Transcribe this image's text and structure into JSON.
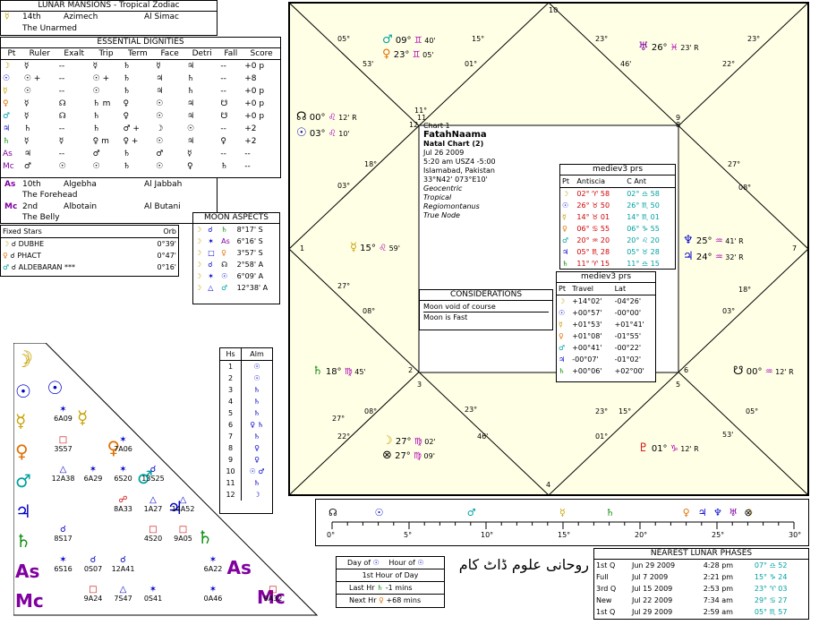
{
  "lunar_mansions": {
    "title": "LUNAR MANSIONS - Tropical Zodiac",
    "row1": {
      "num": "14th",
      "name": "Azimech",
      "arabic": "Al Simac"
    },
    "row1_sub": "The Unarmed",
    "row2": {
      "num": "10th",
      "name": "Algebha",
      "arabic": "Al Jabbah"
    },
    "row2_sub": "The Forehead",
    "row3": {
      "num": "2nd",
      "name": "Albotain",
      "arabic": "Al Butani"
    },
    "row3_sub": "The Belly"
  },
  "essential_dignities": {
    "title": "ESSENTIAL DIGNITIES",
    "headers": [
      "Pt",
      "Ruler",
      "Exalt",
      "Trip",
      "Term",
      "Face",
      "Detri",
      "Fall",
      "Score"
    ],
    "rows": [
      {
        "pt": "☽",
        "ruler": "☿",
        "exalt": "--",
        "trip": "☿",
        "term": "♄",
        "face": "☿",
        "detri": "♃",
        "fall": "--",
        "score": "+0 p"
      },
      {
        "pt": "☉",
        "ruler": "☉ +",
        "exalt": "--",
        "trip": "☉ +",
        "term": "♄",
        "face": "♃",
        "detri": "♄",
        "fall": "--",
        "score": "+8"
      },
      {
        "pt": "☿",
        "ruler": "☉",
        "exalt": "--",
        "trip": "☉",
        "term": "♄",
        "face": "♃",
        "detri": "♄",
        "fall": "--",
        "score": "+0 p"
      },
      {
        "pt": "♀",
        "ruler": "☿",
        "exalt": "☊",
        "trip": "♄ m",
        "term": "♀",
        "face": "☉",
        "detri": "♃",
        "fall": "☋",
        "score": "+0 p"
      },
      {
        "pt": "♂",
        "ruler": "☿",
        "exalt": "☊",
        "trip": "♄",
        "term": "♀",
        "face": "☉",
        "detri": "♃",
        "fall": "☋",
        "score": "+0 p"
      },
      {
        "pt": "♃",
        "ruler": "♄",
        "exalt": "--",
        "trip": "♄",
        "term": "♂ +",
        "face": "☽",
        "detri": "☉",
        "fall": "--",
        "score": "+2"
      },
      {
        "pt": "♄",
        "ruler": "☿",
        "exalt": "☿",
        "trip": "♀ m",
        "term": "♀ +",
        "face": "☉",
        "detri": "♃",
        "fall": "♀",
        "score": "+2"
      },
      {
        "pt": "As",
        "ruler": "♃",
        "exalt": "--",
        "trip": "♂",
        "term": "♄",
        "face": "♂",
        "detri": "☿",
        "fall": "--",
        "score": "--"
      },
      {
        "pt": "Mc",
        "ruler": "♂",
        "exalt": "☉",
        "trip": "☉",
        "term": "♄",
        "face": "☉",
        "detri": "♀",
        "fall": "♄",
        "score": "--"
      }
    ]
  },
  "fixed_stars": {
    "title": "Fixed Stars",
    "orb_label": "Orb",
    "rows": [
      {
        "pt": "☽",
        "asp": "☌",
        "name": "DUBHE",
        "orb": "0°39'"
      },
      {
        "pt": "♀",
        "asp": "☌",
        "name": "PHACT",
        "orb": "0°47'"
      },
      {
        "pt": "♂",
        "asp": "☌",
        "name": "ALDEBARAN ***",
        "orb": "0°16'"
      }
    ]
  },
  "moon_aspects": {
    "title": "MOON ASPECTS",
    "rows": [
      {
        "a": "☽",
        "asp": "☌",
        "b": "♄",
        "val": "8°17' S"
      },
      {
        "a": "☽",
        "asp": "✶",
        "b": "As",
        "val": "6°16' S"
      },
      {
        "a": "☽",
        "asp": "□",
        "b": "♀",
        "val": "3°57' S"
      },
      {
        "a": "☽",
        "asp": "☌",
        "b": "☊",
        "val": "2°58' A"
      },
      {
        "a": "☽",
        "asp": "✶",
        "b": "☉",
        "val": "6°09' A"
      },
      {
        "a": "☽",
        "asp": "△",
        "b": "♂",
        "val": "12°38' A"
      }
    ]
  },
  "houses_almuten": {
    "headers": [
      "Hs",
      "Alm"
    ],
    "rows": [
      {
        "h": "1",
        "a": "☉"
      },
      {
        "h": "2",
        "a": "☉"
      },
      {
        "h": "3",
        "a": "♄"
      },
      {
        "h": "4",
        "a": "♄"
      },
      {
        "h": "5",
        "a": "♄"
      },
      {
        "h": "6",
        "a": "♀ ♄"
      },
      {
        "h": "7",
        "a": "♄"
      },
      {
        "h": "8",
        "a": "♀"
      },
      {
        "h": "9",
        "a": "♀"
      },
      {
        "h": "10",
        "a": "☉ ♂"
      },
      {
        "h": "11",
        "a": "♄"
      },
      {
        "h": "12",
        "a": "☽"
      }
    ]
  },
  "aspect_grid": {
    "planets": [
      "☽",
      "☉",
      "☿",
      "♀",
      "♂",
      "♃",
      "♄",
      "As",
      "Mc"
    ],
    "cells": [
      {
        "sym": "✶",
        "val": "6A09"
      },
      {
        "sym": "□",
        "val": "3S57"
      },
      {
        "sym": "✶",
        "val": "7A06"
      },
      {
        "sym": "△",
        "val": "12A38"
      },
      {
        "sym": "✶",
        "val": "6A29"
      },
      {
        "sym": "✶",
        "val": "6S20"
      },
      {
        "sym": "☌",
        "val": "13S25"
      },
      {
        "sym": "☍",
        "val": "8A33"
      },
      {
        "sym": "△",
        "val": "1A27"
      },
      {
        "sym": "△",
        "val": "14A52"
      },
      {
        "sym": "☌",
        "val": "8S17"
      },
      {
        "sym": "□",
        "val": "4S20"
      },
      {
        "sym": "□",
        "val": "9A05"
      },
      {
        "sym": "✶",
        "val": "6S16"
      },
      {
        "sym": "☌",
        "val": "0S07"
      },
      {
        "sym": "☌",
        "val": "12A41"
      },
      {
        "sym": "✶",
        "val": "6A22"
      },
      {
        "sym": "□",
        "val": "9A24"
      },
      {
        "sym": "△",
        "val": "7S47"
      },
      {
        "sym": "✶",
        "val": "0S41"
      },
      {
        "sym": "✶",
        "val": "0A46"
      },
      {
        "sym": "□",
        "val": "9A32"
      }
    ]
  },
  "chart_info": {
    "chart_num": "Chart 1",
    "name": "FatahNaama",
    "type": "Natal Chart (2)",
    "date": "Jul 26 2009",
    "time": "5:20 am  USZ4 -5:00",
    "place": "Islamabad, Pakistan",
    "coords": "33°N42' 073°E10'",
    "opts": [
      "Geocentric",
      "Tropical",
      "Regiomontanus",
      "True Node"
    ]
  },
  "considerations": {
    "title": "CONSIDERATIONS",
    "lines": [
      "Moon void of course",
      "Moon is Fast"
    ]
  },
  "antiscia": {
    "title": "mediev3 prs",
    "headers": [
      "Pt",
      "Antiscia",
      "C Ant"
    ],
    "rows": [
      {
        "pt": "☽",
        "a": "02° ♈ 58",
        "c": "02° ♎ 58"
      },
      {
        "pt": "☉",
        "a": "26° ♉ 50",
        "c": "26° ♏ 50"
      },
      {
        "pt": "☿",
        "a": "14° ♉ 01",
        "c": "14° ♏ 01"
      },
      {
        "pt": "♀",
        "a": "06° ♋ 55",
        "c": "06° ♑ 55"
      },
      {
        "pt": "♂",
        "a": "20° ♒ 20",
        "c": "20° ♌ 20"
      },
      {
        "pt": "♃",
        "a": "05° ♏ 28",
        "c": "05° ♉ 28"
      },
      {
        "pt": "♄",
        "a": "11° ♈ 15",
        "c": "11° ♎ 15"
      }
    ]
  },
  "travel": {
    "title": "mediev3 prs",
    "headers": [
      "Pt",
      "Travel",
      "Lat"
    ],
    "rows": [
      {
        "pt": "☽",
        "t": "+14°02'",
        "l": "-04°26'"
      },
      {
        "pt": "☉",
        "t": "+00°57'",
        "l": "-00°00'"
      },
      {
        "pt": "☿",
        "t": "+01°53'",
        "l": "+01°41'"
      },
      {
        "pt": "♀",
        "t": "+01°08'",
        "l": "-01°55'"
      },
      {
        "pt": "♂",
        "t": "+00°41'",
        "l": "-00°22'"
      },
      {
        "pt": "♃",
        "t": "-00°07'",
        "l": "-01°02'"
      },
      {
        "pt": "♄",
        "t": "+00°06'",
        "l": "+02°00'"
      }
    ]
  },
  "chart_marks": {
    "house_numbers": [
      "10",
      "11",
      "9",
      "12",
      "8",
      "1",
      "7",
      "2",
      "6",
      "3",
      "5",
      "4"
    ],
    "planets": [
      {
        "glyph": "♂",
        "deg": "09°",
        "sign": "♊",
        "min": "40'"
      },
      {
        "glyph": "♀",
        "deg": "23°",
        "sign": "♊",
        "min": "05'"
      },
      {
        "glyph": "♅",
        "deg": "26°",
        "sign": "♓",
        "min": "23' R"
      },
      {
        "glyph": "☊",
        "deg": "00°",
        "sign": "♌",
        "min": "12' R"
      },
      {
        "glyph": "☉",
        "deg": "03°",
        "sign": "♌",
        "min": "10'"
      },
      {
        "glyph": "☿",
        "deg": "15°",
        "sign": "♌",
        "min": "59'"
      },
      {
        "glyph": "♆",
        "deg": "25°",
        "sign": "♒",
        "min": "41' R"
      },
      {
        "glyph": "♃",
        "deg": "24°",
        "sign": "♒",
        "min": "32' R"
      },
      {
        "glyph": "♄",
        "deg": "18°",
        "sign": "♍",
        "min": "45'"
      },
      {
        "glyph": "☋",
        "deg": "00°",
        "sign": "♒",
        "min": "12' R"
      },
      {
        "glyph": "☽",
        "deg": "27°",
        "sign": "♍",
        "min": "02'"
      },
      {
        "glyph": "⊗",
        "deg": "27°",
        "sign": "♍",
        "min": "09'"
      },
      {
        "glyph": "♇",
        "deg": "01°",
        "sign": "♑",
        "min": "12' R"
      }
    ],
    "cusps": [
      "05°",
      "53'",
      "15°",
      "01°",
      "23°",
      "46'",
      "23°",
      "22°",
      "11°",
      "18°",
      "03°",
      "27°",
      "08°",
      "27°",
      "08°",
      "18°",
      "03°",
      "27°",
      "08°",
      "23°",
      "22°",
      "23°",
      "46'",
      "15°",
      "01°",
      "05°",
      "53'"
    ]
  },
  "timeline": {
    "ticks": [
      "0°",
      "5°",
      "10°",
      "15°",
      "20°",
      "25°",
      "30°"
    ]
  },
  "lunar_phases": {
    "title": "NEAREST LUNAR PHASES",
    "rows": [
      {
        "phase": "1st Q",
        "date": "Jun 29 2009",
        "time": "4:28 pm",
        "pos": "07° ♎ 52"
      },
      {
        "phase": "Full",
        "date": "Jul 7 2009",
        "time": "2:21 pm",
        "pos": "15° ♑ 24"
      },
      {
        "phase": "3rd Q",
        "date": "Jul 15 2009",
        "time": "2:53 pm",
        "pos": "23° ♈ 03"
      },
      {
        "phase": "New",
        "date": "Jul 22 2009",
        "time": "7:34 am",
        "pos": "29° ♋ 27"
      },
      {
        "phase": "1st Q",
        "date": "Jul 29 2009",
        "time": "2:59 am",
        "pos": "05° ♏ 57"
      }
    ]
  },
  "day_hour": {
    "day_label": "Day of",
    "hour_label": "Hour of",
    "first_hour": "1st Hour of Day",
    "last_hr": "Last Hr",
    "last_val": "-1 mins",
    "next_hr": "Next Hr",
    "next_val": "+68 mins"
  },
  "urdu_text": "روحانی علوم ڈاٹ کام"
}
